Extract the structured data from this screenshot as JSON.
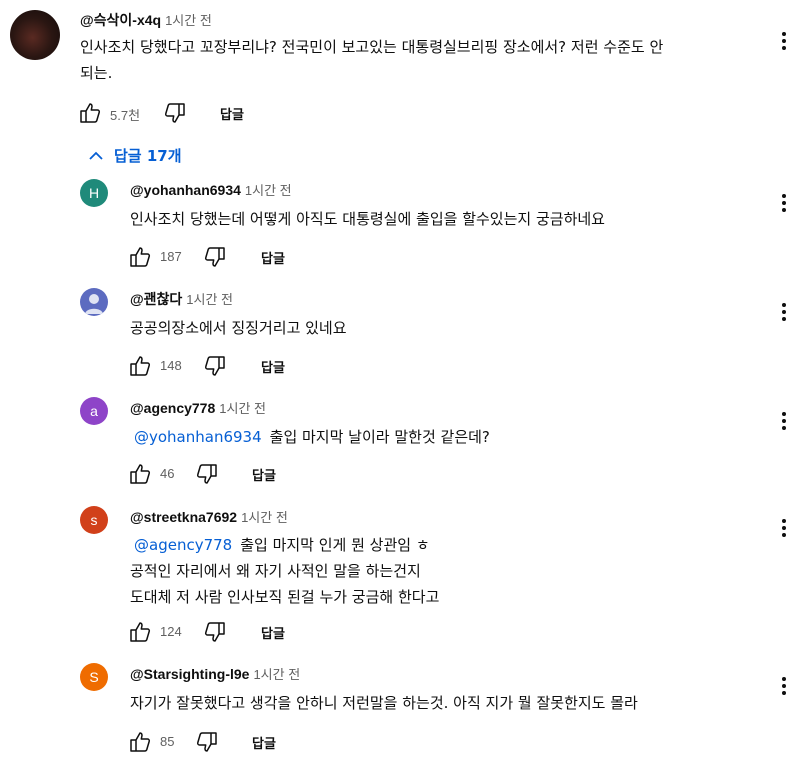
{
  "comment": {
    "author": "@슥삭이-x4q",
    "time": "1시간 전",
    "text_line1": "인사조치 당했다고 꼬장부리냐? 전국민이 보고있는 대통령실브리핑 장소에서? 저런 수준도 안",
    "text_line2": "되는.",
    "likes": "5.7천",
    "reply_label": "답글"
  },
  "replies_toggle": {
    "label": "답글 17개"
  },
  "replies": [
    {
      "avatar_letter": "H",
      "avatar_color": "#1f8a7a",
      "author": "@yohanhan6934",
      "time": "1시간 전",
      "lines": [
        "인사조치 당했는데 어떻게 아직도 대통령실에 출입을 할수있는지 궁금하네요"
      ],
      "likes": "187",
      "reply_label": "답글"
    },
    {
      "avatar_letter": "",
      "avatar_color": "#5c6bc0",
      "author": "@괜찮다",
      "time": "1시간 전",
      "lines": [
        "공공의장소에서 징징거리고 있네요"
      ],
      "likes": "148",
      "reply_label": "답글"
    },
    {
      "avatar_letter": "a",
      "avatar_color": "#8e44c8",
      "author": "@agency778",
      "time": "1시간 전",
      "mention": "@yohanhan6934",
      "lines": [
        "출입 마지막 날이라 말한것 같은데?"
      ],
      "likes": "46",
      "reply_label": "답글"
    },
    {
      "avatar_letter": "s",
      "avatar_color": "#d1401a",
      "author": "@streetkna7692",
      "time": "1시간 전",
      "mention": "@agency778",
      "lines": [
        "출입 마지막 인게 뭔 상관임 ㅎ",
        "공적인 자리에서 왜 자기 사적인 말을 하는건지",
        "도대체 저 사람 인사보직 된걸 누가 궁금해 한다고"
      ],
      "likes": "124",
      "reply_label": "답글"
    },
    {
      "avatar_letter": "S",
      "avatar_color": "#ef6c00",
      "author": "@Starsighting-l9e",
      "time": "1시간 전",
      "lines": [
        "자기가 잘못했다고 생각을 안하니 저런말을 하는것. 아직 지가 뭘 잘못한지도 몰라"
      ],
      "likes": "85",
      "reply_label": "답글"
    }
  ]
}
